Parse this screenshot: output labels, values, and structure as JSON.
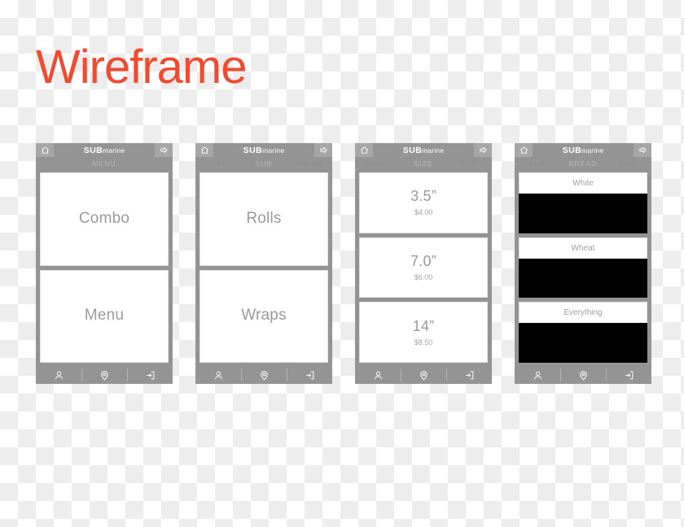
{
  "title": "Wireframe",
  "colors": {
    "title": "#ef4b33",
    "phone_chrome": "#949494",
    "card_bg": "#ffffff",
    "card_border": "#e2e2e2",
    "card_text": "#9a9a9a",
    "thumb": "#000000"
  },
  "brand": {
    "bold": "SUB",
    "normal": "marine"
  },
  "icons": {
    "home": "home-icon",
    "forward": "arrow-right-icon",
    "account": "person-icon",
    "location": "location-pin-icon",
    "logout": "logout-icon"
  },
  "nav": {
    "account_label": "Account",
    "location_label": "Location",
    "logout_label": "Logout"
  },
  "screens": [
    {
      "id": "menu",
      "breadcrumb": {
        "left": "",
        "current": "MENU",
        "right": ""
      },
      "type": "cards",
      "items": [
        {
          "label": "Combo"
        },
        {
          "label": "Menu"
        }
      ]
    },
    {
      "id": "sub",
      "breadcrumb": {
        "left": "EAT",
        "current": "SUB",
        "right": "BREAD"
      },
      "type": "cards",
      "items": [
        {
          "label": "Rolls"
        },
        {
          "label": "Wraps"
        }
      ]
    },
    {
      "id": "size",
      "breadcrumb": {
        "left": "BREAD",
        "current": "SIZE",
        "right": "MEAT"
      },
      "type": "size-cards",
      "items": [
        {
          "label": "3.5”",
          "price": "$4.00"
        },
        {
          "label": "7.0”",
          "price": "$6.00"
        },
        {
          "label": "14”",
          "price": "$8.50"
        }
      ]
    },
    {
      "id": "bread",
      "breadcrumb": {
        "left": "SUB",
        "current": "BREAD",
        "right": "SIZE"
      },
      "type": "bread-list",
      "items": [
        {
          "label": "White"
        },
        {
          "label": "Wheat"
        },
        {
          "label": "Everything"
        }
      ]
    }
  ]
}
